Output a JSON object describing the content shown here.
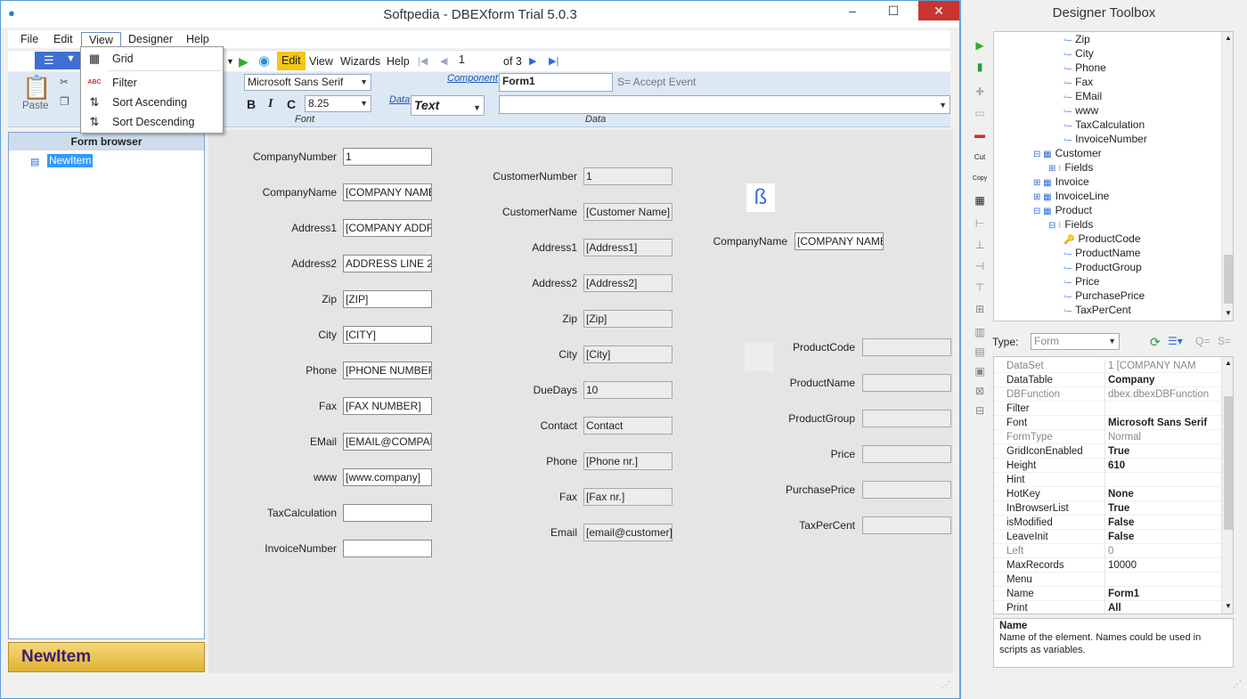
{
  "window": {
    "title": "Softpedia - DBEXform Trial  5.0.3",
    "min": "–",
    "max": "☐",
    "close": "✕"
  },
  "menu": [
    "File",
    "Edit",
    "View",
    "Designer",
    "Help"
  ],
  "view_menu": [
    {
      "icon": "▦",
      "label": "Grid"
    },
    {
      "icon": "ABC",
      "label": "Filter"
    },
    {
      "icon": "⇅",
      "label": "Sort Ascending"
    },
    {
      "icon": "⇅",
      "label": "Sort Descending"
    }
  ],
  "toolbar": {
    "edit": "Edit",
    "view": "View",
    "wizards": "Wizards",
    "help": "Help",
    "record": "1",
    "of": "of 3"
  },
  "ribbon": {
    "paste": "Paste",
    "font_name": "Microsoft Sans Serif",
    "font_size": "8.25",
    "bold": "B",
    "italic": "I",
    "c": "C",
    "font_label": "Font",
    "data_link": "Data",
    "data_type": "Text",
    "component_link": "Component",
    "component_value": "Form1",
    "accept_event": "S= Accept Event",
    "data_label": "Data"
  },
  "form_browser": {
    "header": "Form browser",
    "item": "NewItem",
    "button": "NewItem"
  },
  "form_left": [
    {
      "label": "CompanyNumber",
      "value": "1"
    },
    {
      "label": "CompanyName",
      "value": "[COMPANY NAME]"
    },
    {
      "label": "Address1",
      "value": "[COMPANY ADDRE"
    },
    {
      "label": "Address2",
      "value": " ADDRESS LINE 2]"
    },
    {
      "label": "Zip",
      "value": "[ZIP]"
    },
    {
      "label": "City",
      "value": "[CITY]"
    },
    {
      "label": "Phone",
      "value": "[PHONE NUMBER]"
    },
    {
      "label": "Fax",
      "value": "[FAX NUMBER]"
    },
    {
      "label": "EMail",
      "value": "[EMAIL@COMPAN`"
    },
    {
      "label": "www",
      "value": "[www.company]"
    },
    {
      "label": "TaxCalculation",
      "value": ""
    },
    {
      "label": "InvoiceNumber",
      "value": ""
    }
  ],
  "form_mid": [
    {
      "label": "CustomerNumber",
      "value": "1"
    },
    {
      "label": "CustomerName",
      "value": "[Customer Name]"
    },
    {
      "label": "Address1",
      "value": "[Address1]"
    },
    {
      "label": "Address2",
      "value": "[Address2]"
    },
    {
      "label": "Zip",
      "value": "[Zip]"
    },
    {
      "label": "City",
      "value": "[City]"
    },
    {
      "label": "DueDays",
      "value": "10"
    },
    {
      "label": "Contact",
      "value": "Contact"
    },
    {
      "label": "Phone",
      "value": "[Phone nr.]"
    },
    {
      "label": "Fax",
      "value": "[Fax nr.]"
    },
    {
      "label": "Email",
      "value": "[email@customer]"
    }
  ],
  "form_right_company": {
    "label": "CompanyName",
    "value": "[COMPANY NAME]"
  },
  "form_right": [
    {
      "label": "ProductCode",
      "value": ""
    },
    {
      "label": "ProductName",
      "value": ""
    },
    {
      "label": "ProductGroup",
      "value": ""
    },
    {
      "label": "Price",
      "value": ""
    },
    {
      "label": "PurchasePrice",
      "value": ""
    },
    {
      "label": "TaxPerCent",
      "value": ""
    }
  ],
  "toolbox": {
    "title": "Designer Toolbox",
    "tree": [
      {
        "indent": 5,
        "kind": "field",
        "label": "Zip"
      },
      {
        "indent": 5,
        "kind": "field",
        "label": "City"
      },
      {
        "indent": 5,
        "kind": "field",
        "label": "Phone"
      },
      {
        "indent": 5,
        "kind": "field",
        "label": "Fax"
      },
      {
        "indent": 5,
        "kind": "field",
        "label": "EMail"
      },
      {
        "indent": 5,
        "kind": "field",
        "label": "www"
      },
      {
        "indent": 5,
        "kind": "field",
        "label": "TaxCalculation"
      },
      {
        "indent": 5,
        "kind": "field",
        "label": "InvoiceNumber"
      },
      {
        "indent": 3,
        "kind": "table-open",
        "label": "Customer"
      },
      {
        "indent": 4,
        "kind": "fields-closed",
        "label": "Fields"
      },
      {
        "indent": 3,
        "kind": "table-closed",
        "label": "Invoice"
      },
      {
        "indent": 3,
        "kind": "table-closed",
        "label": "InvoiceLine"
      },
      {
        "indent": 3,
        "kind": "table-open",
        "label": "Product"
      },
      {
        "indent": 4,
        "kind": "fields-open",
        "label": "Fields"
      },
      {
        "indent": 5,
        "kind": "key",
        "label": "ProductCode"
      },
      {
        "indent": 5,
        "kind": "field",
        "label": "ProductName"
      },
      {
        "indent": 5,
        "kind": "field",
        "label": "ProductGroup"
      },
      {
        "indent": 5,
        "kind": "field",
        "label": "Price"
      },
      {
        "indent": 5,
        "kind": "field",
        "label": "PurchasePrice"
      },
      {
        "indent": 5,
        "kind": "field",
        "label": "TaxPerCent"
      }
    ],
    "type_label": "Type:",
    "type_value": "Form",
    "props": [
      {
        "name": "DataSet",
        "value": "1            [COMPANY NAM",
        "grey": true,
        "bold": false
      },
      {
        "name": "DataTable",
        "value": "Company",
        "grey": false,
        "bold": true
      },
      {
        "name": "DBFunction",
        "value": "dbex.dbexDBFunction",
        "grey": true,
        "bold": false
      },
      {
        "name": "Filter",
        "value": "",
        "grey": false,
        "bold": false
      },
      {
        "name": "Font",
        "value": "Microsoft Sans Serif",
        "grey": false,
        "bold": true
      },
      {
        "name": "FormType",
        "value": "Normal",
        "grey": true,
        "bold": false
      },
      {
        "name": "GridIconEnabled",
        "value": "True",
        "grey": false,
        "bold": true
      },
      {
        "name": "Height",
        "value": "610",
        "grey": false,
        "bold": true
      },
      {
        "name": "Hint",
        "value": "",
        "grey": false,
        "bold": false
      },
      {
        "name": "HotKey",
        "value": "None",
        "grey": false,
        "bold": true
      },
      {
        "name": "InBrowserList",
        "value": "True",
        "grey": false,
        "bold": true
      },
      {
        "name": "isModified",
        "value": "False",
        "grey": false,
        "bold": true
      },
      {
        "name": "LeaveInit",
        "value": "False",
        "grey": false,
        "bold": true
      },
      {
        "name": "Left",
        "value": "0",
        "grey": true,
        "bold": false
      },
      {
        "name": "MaxRecords",
        "value": "10000",
        "grey": false,
        "bold": false
      },
      {
        "name": "Menu",
        "value": "",
        "grey": false,
        "bold": false
      },
      {
        "name": "Name",
        "value": "Form1",
        "grey": false,
        "bold": true
      },
      {
        "name": "Print",
        "value": "All",
        "grey": false,
        "bold": true
      }
    ],
    "help_title": "Name",
    "help_text": "Name of the element. Names could be used in scripts as variables."
  },
  "colors": {
    "accent": "#5b9bd5",
    "close": "#c7362f",
    "newitem": "#3c1f6e"
  }
}
